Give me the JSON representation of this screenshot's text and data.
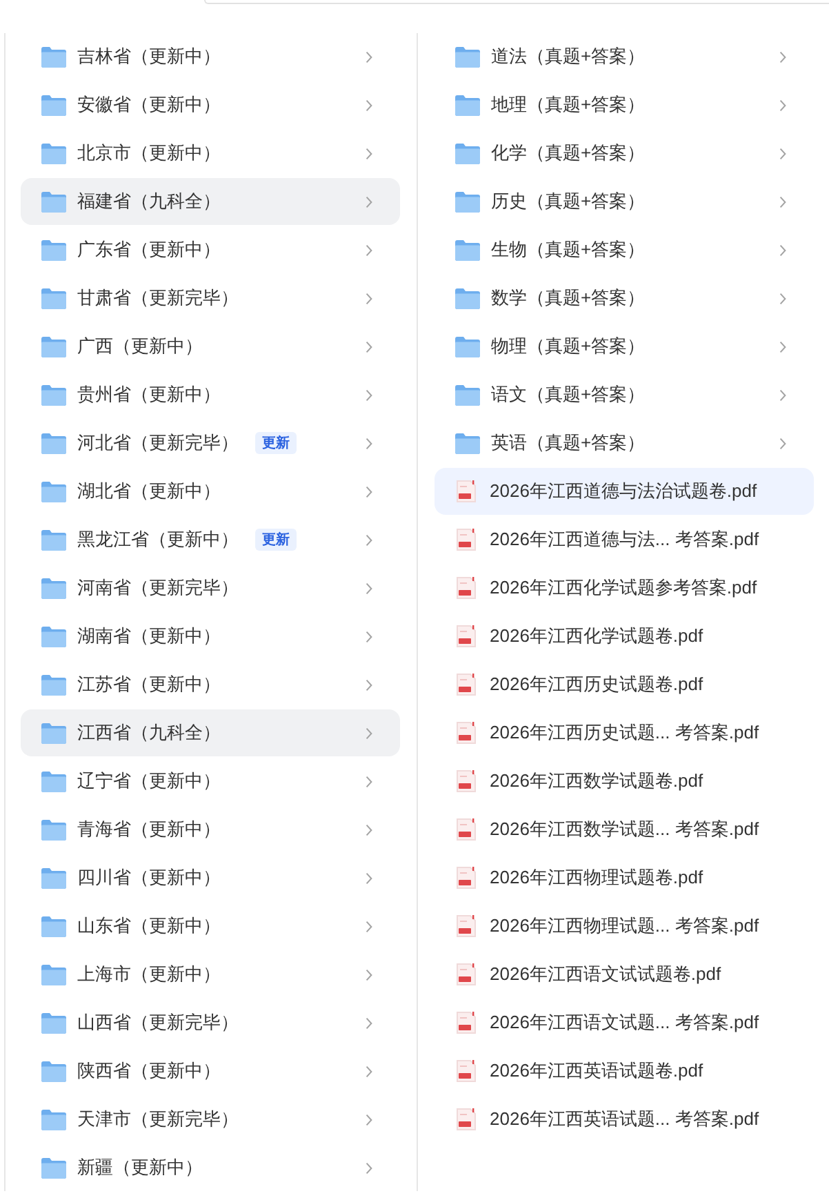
{
  "region_list": {
    "items": [
      {
        "label": "吉林省（更新中）",
        "selected": false
      },
      {
        "label": "安徽省（更新中）",
        "selected": false
      },
      {
        "label": "北京市（更新中）",
        "selected": false
      },
      {
        "label": "福建省（九科全）",
        "selected": true
      },
      {
        "label": "广东省（更新中）",
        "selected": false
      },
      {
        "label": "甘肃省（更新完毕）",
        "selected": false
      },
      {
        "label": "广西（更新中）",
        "selected": false
      },
      {
        "label": "贵州省（更新中）",
        "selected": false
      },
      {
        "label": "河北省（更新完毕）",
        "selected": false,
        "badge": "更新"
      },
      {
        "label": "湖北省（更新中）",
        "selected": false
      },
      {
        "label": "黑龙江省（更新中）",
        "selected": false,
        "badge": "更新"
      },
      {
        "label": "河南省（更新完毕）",
        "selected": false
      },
      {
        "label": "湖南省（更新中）",
        "selected": false
      },
      {
        "label": "江苏省（更新中）",
        "selected": false
      },
      {
        "label": "江西省（九科全）",
        "selected": true
      },
      {
        "label": "辽宁省（更新中）",
        "selected": false
      },
      {
        "label": "青海省（更新中）",
        "selected": false
      },
      {
        "label": "四川省（更新中）",
        "selected": false
      },
      {
        "label": "山东省（更新中）",
        "selected": false
      },
      {
        "label": "上海市（更新中）",
        "selected": false
      },
      {
        "label": "山西省（更新完毕）",
        "selected": false
      },
      {
        "label": "陕西省（更新中）",
        "selected": false
      },
      {
        "label": "天津市（更新完毕）",
        "selected": false
      },
      {
        "label": "新疆（更新中）",
        "selected": false
      }
    ]
  },
  "subject_list": {
    "items": [
      {
        "kind": "folder",
        "label": "道法（真题+答案）",
        "selected": false
      },
      {
        "kind": "folder",
        "label": "地理（真题+答案）",
        "selected": false
      },
      {
        "kind": "folder",
        "label": "化学（真题+答案）",
        "selected": false
      },
      {
        "kind": "folder",
        "label": "历史（真题+答案）",
        "selected": false
      },
      {
        "kind": "folder",
        "label": "生物（真题+答案）",
        "selected": false
      },
      {
        "kind": "folder",
        "label": "数学（真题+答案）",
        "selected": false
      },
      {
        "kind": "folder",
        "label": "物理（真题+答案）",
        "selected": false
      },
      {
        "kind": "folder",
        "label": "语文（真题+答案）",
        "selected": false
      },
      {
        "kind": "folder",
        "label": "英语（真题+答案）",
        "selected": false
      },
      {
        "kind": "pdf",
        "label": "2026年江西道德与法治试题卷.pdf",
        "selected": true
      },
      {
        "kind": "pdf",
        "label": "2026年江西道德与法... 考答案.pdf",
        "selected": false
      },
      {
        "kind": "pdf",
        "label": "2026年江西化学试题参考答案.pdf",
        "selected": false
      },
      {
        "kind": "pdf",
        "label": "2026年江西化学试题卷.pdf",
        "selected": false
      },
      {
        "kind": "pdf",
        "label": "2026年江西历史试题卷.pdf",
        "selected": false
      },
      {
        "kind": "pdf",
        "label": "2026年江西历史试题... 考答案.pdf",
        "selected": false
      },
      {
        "kind": "pdf",
        "label": "2026年江西数学试题卷.pdf",
        "selected": false
      },
      {
        "kind": "pdf",
        "label": "2026年江西数学试题... 考答案.pdf",
        "selected": false
      },
      {
        "kind": "pdf",
        "label": "2026年江西物理试题卷.pdf",
        "selected": false
      },
      {
        "kind": "pdf",
        "label": "2026年江西物理试题... 考答案.pdf",
        "selected": false
      },
      {
        "kind": "pdf",
        "label": "2026年江西语文试试题卷.pdf",
        "selected": false
      },
      {
        "kind": "pdf",
        "label": "2026年江西语文试题... 考答案.pdf",
        "selected": false
      },
      {
        "kind": "pdf",
        "label": "2026年江西英语试题卷.pdf",
        "selected": false
      },
      {
        "kind": "pdf",
        "label": "2026年江西英语试题... 考答案.pdf",
        "selected": false
      }
    ]
  }
}
